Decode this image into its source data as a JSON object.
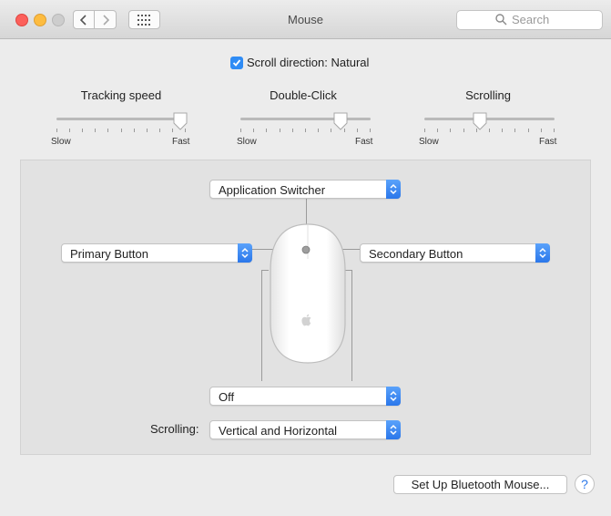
{
  "window": {
    "title": "Mouse"
  },
  "search": {
    "placeholder": "Search"
  },
  "scroll_direction": {
    "label": "Scroll direction: Natural",
    "checked": true
  },
  "sliders": [
    {
      "title": "Tracking speed",
      "min_label": "Slow",
      "max_label": "Fast",
      "value": 0.95
    },
    {
      "title": "Double-Click",
      "min_label": "Slow",
      "max_label": "Fast",
      "value": 0.77
    },
    {
      "title": "Scrolling",
      "min_label": "Slow",
      "max_label": "Fast",
      "value": 0.43
    }
  ],
  "buttons_panel": {
    "top": "Application Switcher",
    "left": "Primary Button",
    "right": "Secondary Button",
    "bottom": "Off",
    "scrolling_label": "Scrolling:",
    "scrolling_value": "Vertical and Horizontal"
  },
  "footer": {
    "setup_label": "Set Up Bluetooth Mouse...",
    "help_label": "?"
  },
  "icons": [
    "chevron-left-icon",
    "chevron-right-icon",
    "grid-icon",
    "search-icon",
    "checkmark-icon",
    "updown-arrow-icon",
    "apple-logo-icon"
  ],
  "colors": {
    "accent": "#2f8cf5"
  }
}
